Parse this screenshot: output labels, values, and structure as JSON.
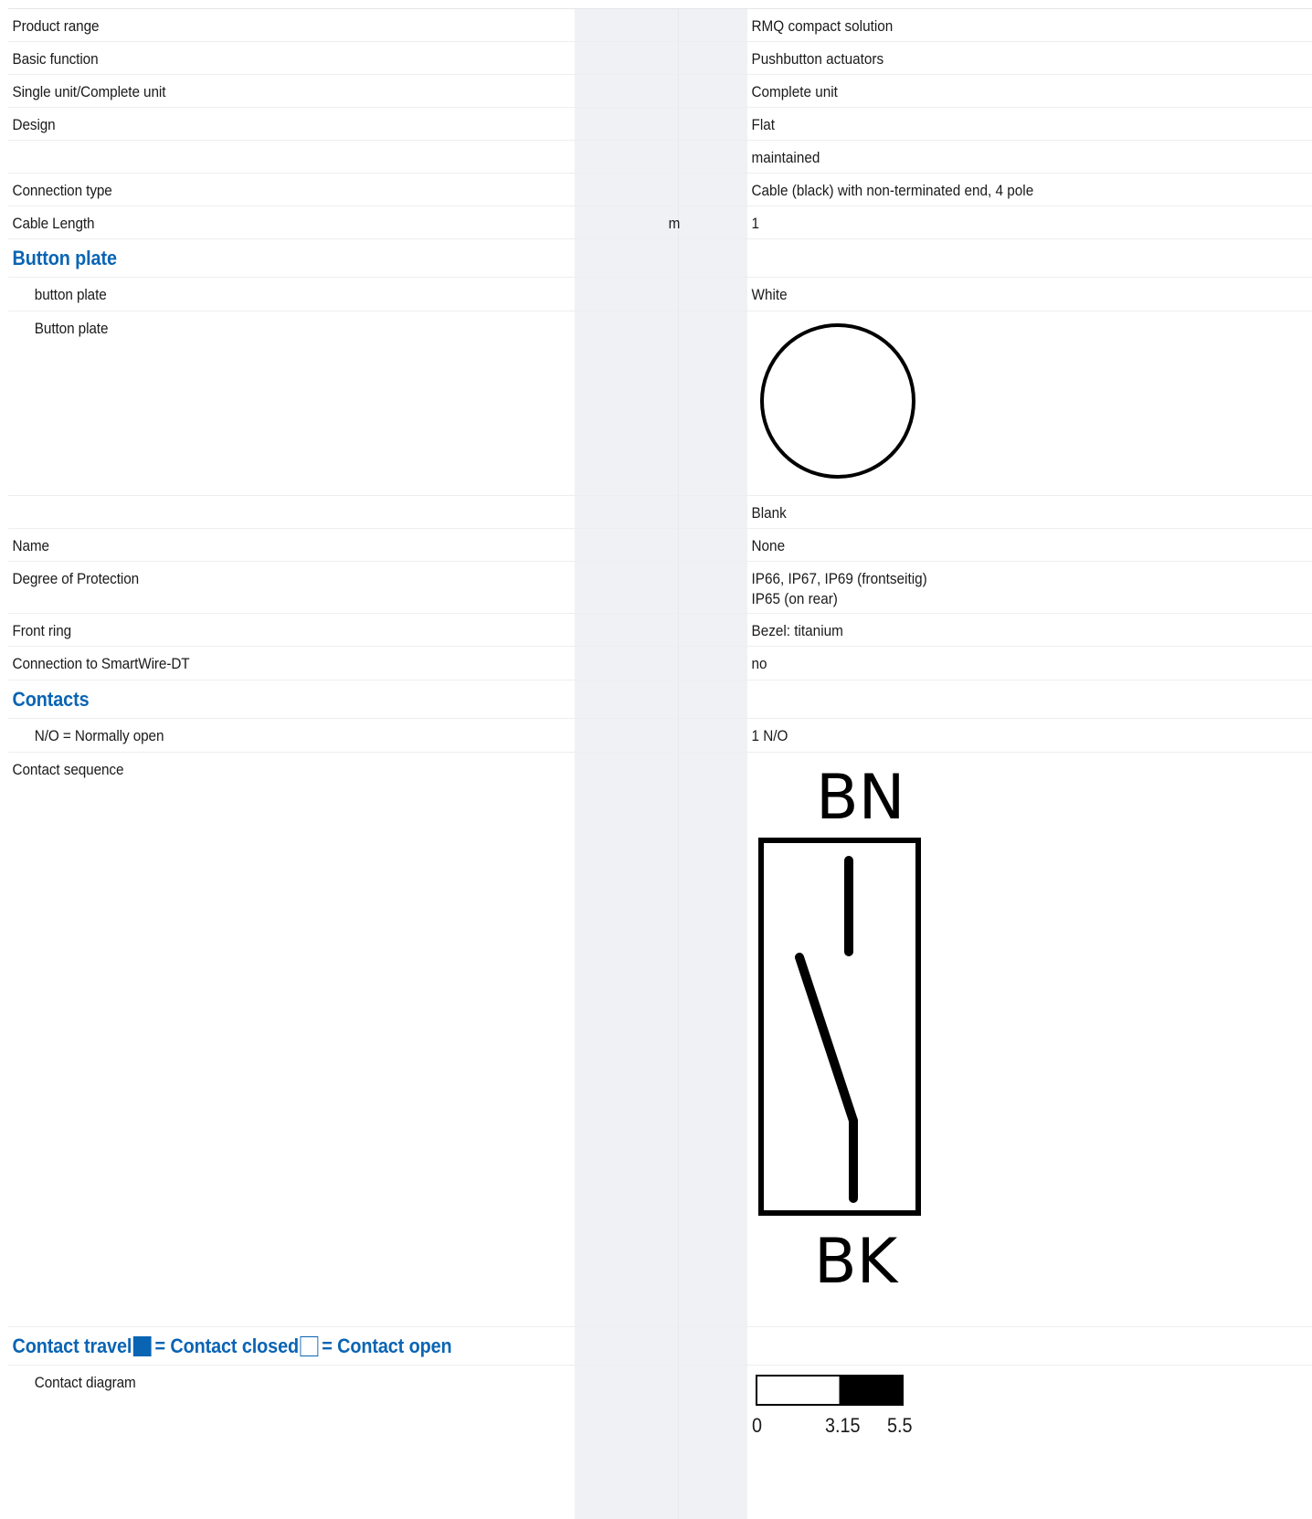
{
  "rows": [
    {
      "label": "Product range",
      "value": "RMQ compact solution"
    },
    {
      "label": "Basic function",
      "value": "Pushbutton actuators"
    },
    {
      "label": "Single unit/Complete unit",
      "value": "Complete unit"
    },
    {
      "label": "Design",
      "value": "Flat"
    },
    {
      "label": "",
      "value": "maintained"
    },
    {
      "label": "Connection type",
      "value": "Cable (black) with non-terminated end, 4 pole"
    },
    {
      "label": "Cable Length",
      "unit": "m",
      "value": "1"
    }
  ],
  "button_plate": {
    "heading": "Button plate",
    "color_label": "button plate",
    "color_value": "White",
    "plate_label": "Button plate",
    "plate_value": "Blank"
  },
  "rows2": [
    {
      "label": "Name",
      "value": "None"
    },
    {
      "label": "Degree of Protection",
      "value_line1": "IP66, IP67, IP69 (frontseitig)",
      "value_line2": "IP65 (on rear)"
    },
    {
      "label": "Front ring",
      "value": "Bezel: titanium"
    },
    {
      "label": "Connection to SmartWire-DT",
      "value": "no"
    }
  ],
  "contacts": {
    "heading": "Contacts",
    "no_label": "N/O = Normally open",
    "no_value": "1 N/O",
    "sequence_label": "Contact sequence",
    "top_terminal": "BN",
    "bottom_terminal": "BK"
  },
  "legend": {
    "title_part1": "Contact travel",
    "title_part2": "= Contact closed",
    "title_part3": "= Contact open",
    "closed_color": "#0a64b4"
  },
  "contact_diagram": {
    "label": "Contact diagram",
    "ticks": [
      "0",
      "3.15",
      "5.5"
    ],
    "travel_max": 5.5,
    "closed_from": 3.15
  }
}
